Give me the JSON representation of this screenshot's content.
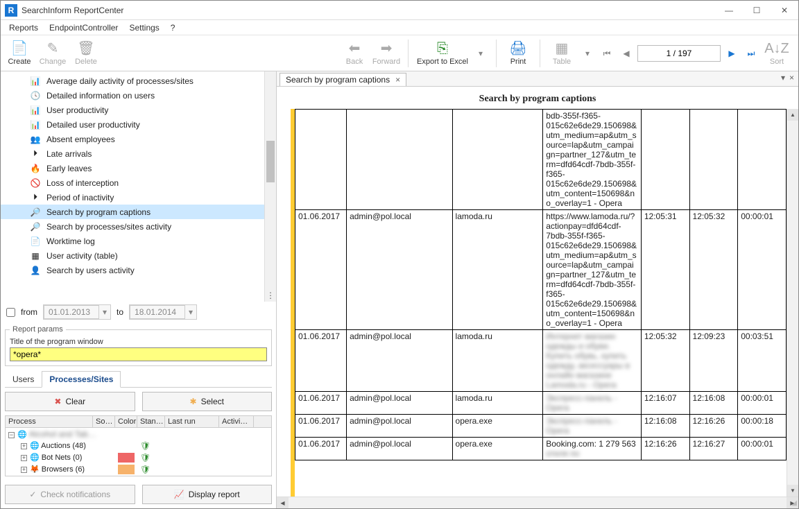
{
  "app": {
    "title": "SearchInform ReportCenter"
  },
  "menu": {
    "reports": "Reports",
    "endpoint": "EndpointController",
    "settings": "Settings",
    "help": "?"
  },
  "toolbar": {
    "create": "Create",
    "change": "Change",
    "delete": "Delete",
    "back": "Back",
    "forward": "Forward",
    "export": "Export to Excel",
    "print": "Print",
    "table": "Table",
    "sort": "Sort",
    "page": "1 / 197"
  },
  "tree": [
    {
      "icon": "📊",
      "label": "Average daily activity of processes/sites"
    },
    {
      "icon": "🕓",
      "label": "Detailed information on users"
    },
    {
      "icon": "📊",
      "label": "User productivity"
    },
    {
      "icon": "📊",
      "label": "Detailed user productivity"
    },
    {
      "icon": "👥",
      "label": "Absent employees"
    },
    {
      "icon": "⏵",
      "label": "Late arrivals"
    },
    {
      "icon": "🔥",
      "label": "Early leaves"
    },
    {
      "icon": "🚫",
      "label": "Loss of interception"
    },
    {
      "icon": "⏵",
      "label": "Period of inactivity"
    },
    {
      "icon": "🔎",
      "label": "Search by program captions",
      "selected": true
    },
    {
      "icon": "🔎",
      "label": "Search by processes/sites activity"
    },
    {
      "icon": "📄",
      "label": "Worktime log"
    },
    {
      "icon": "▦",
      "label": "User activity (table)"
    },
    {
      "icon": "👤",
      "label": "Search by users activity"
    }
  ],
  "date": {
    "from_label": "from",
    "from": "01.01.2013",
    "to_label": "to",
    "to": "18.01.2014"
  },
  "params": {
    "legend": "Report params",
    "title_label": "Title of the program window",
    "title_value": "*opera*"
  },
  "tabs": {
    "users": "Users",
    "processes": "Processes/Sites"
  },
  "buttons": {
    "clear": "Clear",
    "select": "Select",
    "check": "Check notifications",
    "display": "Display report"
  },
  "grid": {
    "headers": {
      "process": "Process",
      "sort": "So…",
      "color": "Color",
      "stan": "Stan…",
      "last": "Last run",
      "act": "Activi…"
    },
    "rows": [
      {
        "indent": 1,
        "icon": "🌐",
        "label": "Auctions (48)",
        "color": "",
        "shield": true
      },
      {
        "indent": 1,
        "icon": "🌐",
        "label": "Bot Nets (0)",
        "color": "#e66",
        "shield": true
      },
      {
        "indent": 1,
        "icon": "🦊",
        "label": "Browsers (6)",
        "color": "#f6b26b",
        "shield": true
      }
    ]
  },
  "doc_tab": {
    "label": "Search by program captions"
  },
  "report": {
    "title": "Search by program captions",
    "rows": [
      {
        "date": "",
        "user": "",
        "site": "",
        "url": "bdb-355f-f365-015c62e6de29.150698&utm_medium=ap&utm_source=lap&utm_campaign=partner_127&utm_term=dfd64cdf-7bdb-355f-f365-015c62e6de29.150698&utm_content=150698&no_overlay=1 - Opera",
        "t1": "",
        "t2": "",
        "dur": ""
      },
      {
        "date": "01.06.2017",
        "user": "admin@pol.local",
        "site": "lamoda.ru",
        "url": "https://www.lamoda.ru/?actionpay=dfd64cdf-7bdb-355f-f365-015c62e6de29.150698&utm_medium=ap&utm_source=lap&utm_campaign=partner_127&utm_term=dfd64cdf-7bdb-355f-f365-015c62e6de29.150698&utm_content=150698&no_overlay=1 - Opera",
        "t1": "12:05:31",
        "t2": "12:05:32",
        "dur": "00:00:01"
      },
      {
        "date": "01.06.2017",
        "user": "admin@pol.local",
        "site": "lamoda.ru",
        "url": "Интернет магазин одежды и обуви. Купить обувь, купить одежду, аксессуары в онлайн магазине Lamoda.ru - Opera",
        "blur": true,
        "t1": "12:05:32",
        "t2": "12:09:23",
        "dur": "00:03:51"
      },
      {
        "date": "01.06.2017",
        "user": "admin@pol.local",
        "site": "lamoda.ru",
        "url": "Экспресс-панель - Opera",
        "blur": true,
        "t1": "12:16:07",
        "t2": "12:16:08",
        "dur": "00:00:01"
      },
      {
        "date": "01.06.2017",
        "user": "admin@pol.local",
        "site": "opera.exe",
        "url": "Экспресс-панель - Opera",
        "blur": true,
        "t1": "12:16:08",
        "t2": "12:16:26",
        "dur": "00:00:18"
      },
      {
        "date": "01.06.2017",
        "user": "admin@pol.local",
        "site": "opera.exe",
        "url": "Booking.com: 1 279 563 отеля по",
        "partblur": true,
        "t1": "12:16:26",
        "t2": "12:16:27",
        "dur": "00:00:01"
      }
    ]
  }
}
